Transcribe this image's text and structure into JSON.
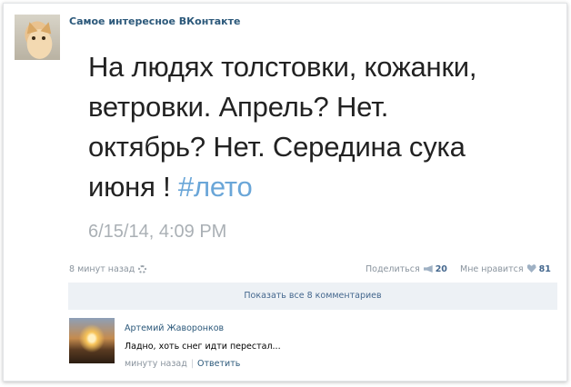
{
  "post": {
    "author": "Самое интересное ВКонтакте",
    "tweet_lines": [
      "На людях толстовки, кожанки,",
      "ветровки. Апрель? Нет.",
      "октябрь? Нет. Середина сука",
      "июня ! "
    ],
    "hashtag": "#лето",
    "tweet_date": "6/15/14, 4:09 PM",
    "time_ago": "8 минут назад",
    "share_label": "Поделиться",
    "share_count": "20",
    "like_label": "Мне нравится",
    "like_count": "81",
    "show_comments": "Показать все 8 комментариев"
  },
  "comment": {
    "author": "Артемий Жаворонков",
    "text": "Ладно, хоть снег идти перестал...",
    "time": "минуту назад",
    "separator": "|",
    "reply_label": "Ответить"
  },
  "colors": {
    "link": "#2b587a",
    "hashtag": "#6aa6d8",
    "meta": "#8a949e",
    "show_comments_bg": "#edf1f5"
  }
}
